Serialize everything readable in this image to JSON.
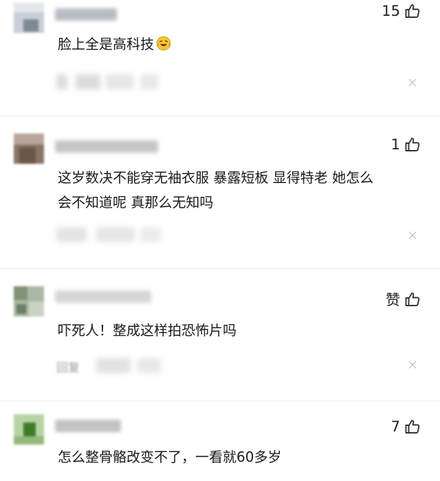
{
  "comments": [
    {
      "likes": "15",
      "text_lines": [
        "脸上全是高科技"
      ],
      "emoji": "laughing-crying-emoji",
      "reply_label": ""
    },
    {
      "likes": "1",
      "text_lines": [
        "这岁数决不能穿无袖衣服 暴露短板 显得特老 她怎么",
        "会不知道呢 真那么无知吗"
      ],
      "emoji": "",
      "reply_label": ""
    },
    {
      "likes": "赞",
      "text_lines": [
        "吓死人！整成这样拍恐怖片吗"
      ],
      "emoji": "",
      "reply_label": "回复"
    },
    {
      "likes": "7",
      "text_lines": [
        "怎么整骨骼改变不了，一看就60多岁"
      ],
      "emoji": "",
      "reply_label": ""
    }
  ],
  "icons": {
    "like": "thumbs-up-icon",
    "dismiss": "close-icon"
  },
  "colors": {
    "text": "#1a1a1a",
    "icon": "#333333",
    "muted": "#c8c8c8",
    "background": "#ffffff"
  }
}
